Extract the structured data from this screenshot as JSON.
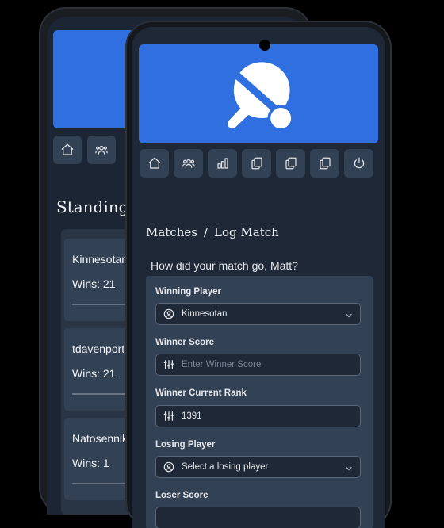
{
  "back_screen": {
    "nav_icons": [
      "home-icon",
      "users-icon"
    ],
    "title": "Standings",
    "standings": [
      {
        "name": "Kinnesotan",
        "wins": "Wins: 21"
      },
      {
        "name": "tdavenport",
        "wins": "Wins: 21"
      },
      {
        "name": "Natosennik",
        "wins": "Wins: 1"
      }
    ]
  },
  "front_screen": {
    "banner_color": "#2f6fe0",
    "banner_icon": "ping-pong-paddle-icon",
    "nav_icons": [
      "home-icon",
      "users-icon",
      "chart-icon",
      "copy-icon",
      "copy-icon",
      "copy-icon",
      "power-icon"
    ],
    "breadcrumb": {
      "root": "Matches",
      "separator": "/",
      "current": "Log Match"
    },
    "question": "How did your match go, Matt?",
    "form": {
      "winning_player": {
        "label": "Winning Player",
        "value": "Kinnesotan"
      },
      "winner_score": {
        "label": "Winner Score",
        "placeholder": "Enter Winner Score"
      },
      "winner_rank": {
        "label": "Winner Current Rank",
        "value": "1391"
      },
      "losing_player": {
        "label": "Losing Player",
        "value": "Select a losing player"
      },
      "loser_score": {
        "label": "Loser Score"
      }
    }
  }
}
